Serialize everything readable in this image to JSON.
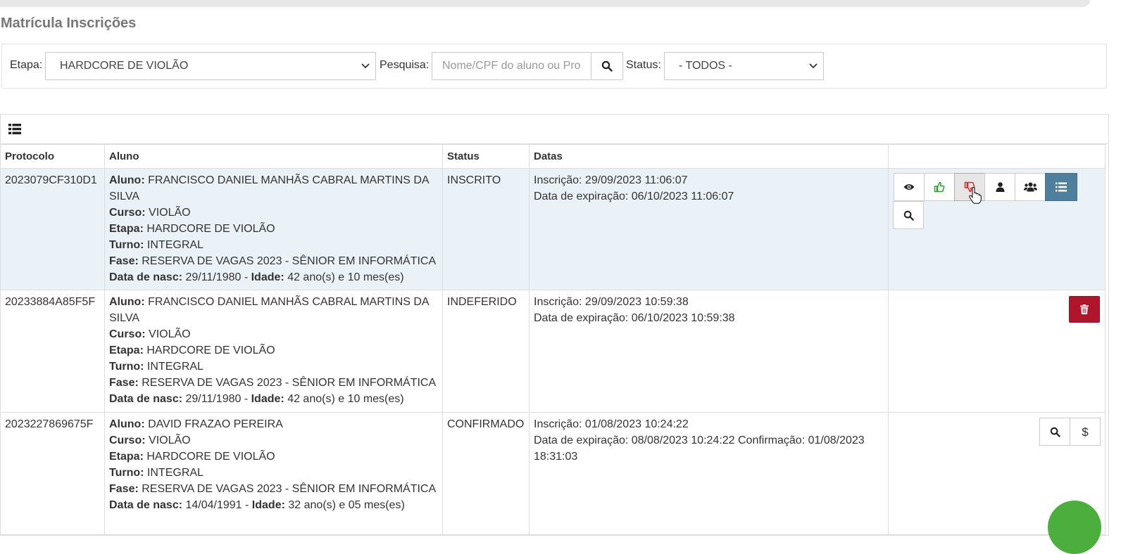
{
  "page": {
    "title": "Matrícula Inscrições"
  },
  "filters": {
    "etapa_label": "Etapa:",
    "etapa_value": "HARDCORE DE VIOLÃO",
    "pesquisa_label": "Pesquisa:",
    "search_placeholder": "Nome/CPF do aluno ou Pro",
    "status_label": "Status:",
    "status_value": "- TODOS -"
  },
  "table": {
    "headers": [
      "Protocolo",
      "Aluno",
      "Status",
      "Datas",
      ""
    ],
    "labels": {
      "aluno": "Aluno:",
      "curso": "Curso:",
      "etapa": "Etapa:",
      "turno": "Turno:",
      "fase": "Fase:",
      "nasc": "Data de nasc:",
      "idade": "Idade:"
    },
    "rows": [
      {
        "protocolo": "2023079CF310D1",
        "aluno": "FRANCISCO DANIEL MANHÃS CABRAL MARTINS DA SILVA",
        "curso": "VIOLÃO",
        "etapa": "HARDCORE DE VIOLÃO",
        "turno": "INTEGRAL",
        "fase": "RESERVA DE VAGAS 2023 - SÊNIOR EM INFORMÁTICA",
        "nasc": "29/11/1980",
        "idade": "42 ano(s) e 10 mes(es)",
        "status": "INSCRITO",
        "inscricao": "Inscrição: 29/09/2023 11:06:07",
        "expiracao": "Data de expiração: 06/10/2023 11:06:07"
      },
      {
        "protocolo": "20233884A85F5F",
        "aluno": "FRANCISCO DANIEL MANHÃS CABRAL MARTINS DA SILVA",
        "curso": "VIOLÃO",
        "etapa": "HARDCORE DE VIOLÃO",
        "turno": "INTEGRAL",
        "fase": "RESERVA DE VAGAS 2023 - SÊNIOR EM INFORMÁTICA",
        "nasc": "29/11/1980",
        "idade": "42 ano(s) e 10 mes(es)",
        "status": "INDEFERIDO",
        "inscricao": "Inscrição: 29/09/2023 10:59:38",
        "expiracao": "Data de expiração: 06/10/2023 10:59:38"
      },
      {
        "protocolo": "2023227869675F",
        "aluno": "DAVID FRAZAO PEREIRA",
        "curso": "VIOLÃO",
        "etapa": "HARDCORE DE VIOLÃO",
        "turno": "INTEGRAL",
        "fase": "RESERVA DE VAGAS 2023 - SÊNIOR EM INFORMÁTICA",
        "nasc": "14/04/1991",
        "idade": "32 ano(s) e 05 mes(es)",
        "status": "CONFIRMADO",
        "inscricao": "Inscrição: 01/08/2023 10:24:22",
        "expiracao": "Data de expiração: 08/08/2023 10:24:22 Confirmação: 01/08/2023 18:31:03"
      }
    ]
  },
  "actions": {
    "dollar_label": "$"
  },
  "icons": {
    "list": "list-icon",
    "search": "search-icon",
    "view": "eye-icon",
    "approve": "thumbs-up-icon",
    "reject": "thumbs-down-icon",
    "user": "user-icon",
    "group": "users-icon",
    "list_ordered": "list-ordered-icon",
    "delete": "trash-icon",
    "chevron": "chevron-down-icon"
  },
  "colors": {
    "active_row": "#eaf2f8",
    "info_button": "#4f7f9c",
    "danger_button": "#b0162b",
    "approve": "#2e9b2e",
    "reject": "#e0242f",
    "fab": "#4caf3d"
  }
}
